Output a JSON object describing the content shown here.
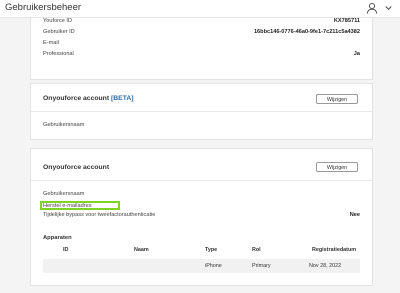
{
  "app": {
    "title": "Gebruikersbeheer"
  },
  "profile": {
    "rows": [
      {
        "label": "Youforce ID",
        "value": "KX785711"
      },
      {
        "label": "Gebruiker ID",
        "value": "16bbc146-0776-46a0-9fe1-7c211c5a4382"
      },
      {
        "label": "E-mail",
        "value": ""
      },
      {
        "label": "Professional",
        "value": "Ja"
      }
    ]
  },
  "onyouforce_beta": {
    "title": "Onyouforce account",
    "badge": "[BETA]",
    "edit_label": "Wijzigen",
    "username_label": "Gebruikersnaam"
  },
  "onyouforce": {
    "title": "Onyouforce account",
    "edit_label": "Wijzigen",
    "username_label": "Gebruikersnaam",
    "recovery_email_label": "Herstel e-mailadres",
    "bypass_label": "Tijdelijke bypass voor tweefactorauthenticatie",
    "bypass_value": "Nee"
  },
  "devices": {
    "title": "Apparaten",
    "columns": [
      "ID",
      "Naam",
      "Type",
      "Rol",
      "Registratiedatum"
    ],
    "rows": [
      {
        "id": "",
        "name": "",
        "type": "iPhone",
        "role": "Primary",
        "date": "Nov 28, 2022"
      }
    ]
  },
  "colors": {
    "highlight": "#7ed321",
    "beta": "#2b6cb0"
  }
}
